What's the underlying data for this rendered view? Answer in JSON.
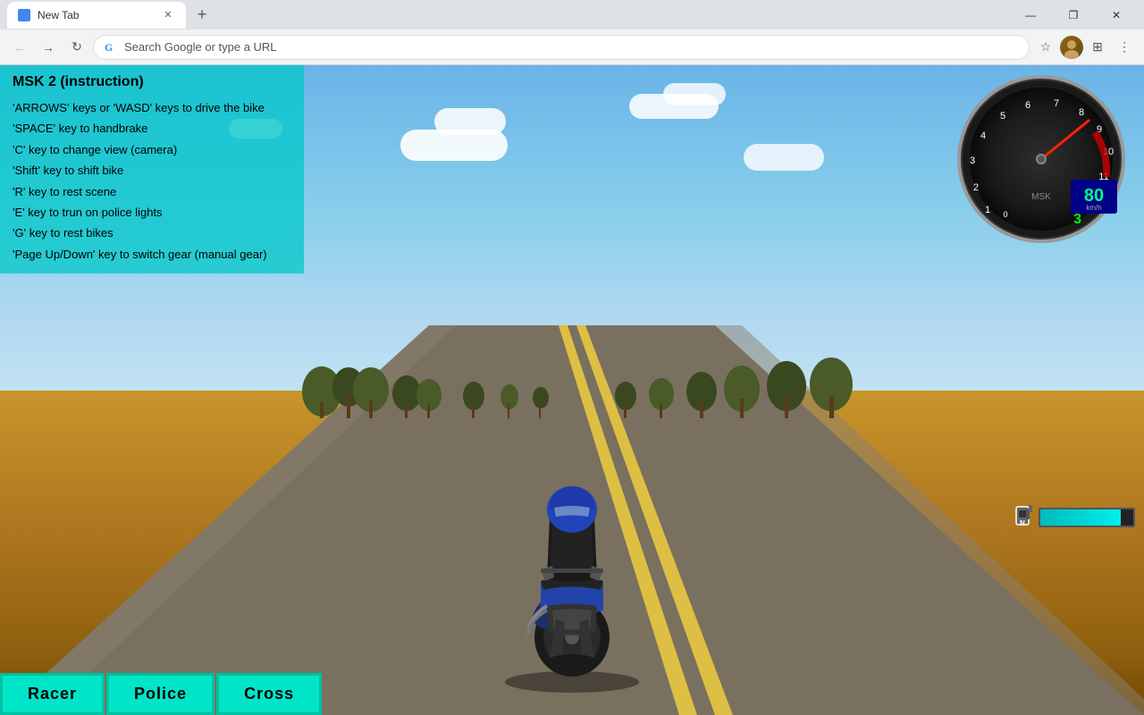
{
  "browser": {
    "tab_label": "New Tab",
    "new_tab_title": "+",
    "address_placeholder": "Search Google or type a URL",
    "window_controls": {
      "minimize": "—",
      "maximize": "❐",
      "close": "✕"
    }
  },
  "game": {
    "title": "MSK 2 (instruction)",
    "instructions": [
      "'ARROWS' keys or 'WASD' keys to drive the bike",
      "'SPACE' key to handbrake",
      "'C' key to change view (camera)",
      "'Shift' key to shift bike",
      "'R' key to rest scene",
      "'E' key to trun on police lights",
      "'G' key to rest bikes",
      "'Page Up/Down' key to switch gear (manual gear)"
    ],
    "buttons": [
      {
        "label": "Racer",
        "id": "racer"
      },
      {
        "label": "Police",
        "id": "police"
      },
      {
        "label": "Cross",
        "id": "cross"
      }
    ],
    "speedometer": {
      "speed_value": "80",
      "speed_unit": "km/h",
      "gear": "3"
    }
  }
}
